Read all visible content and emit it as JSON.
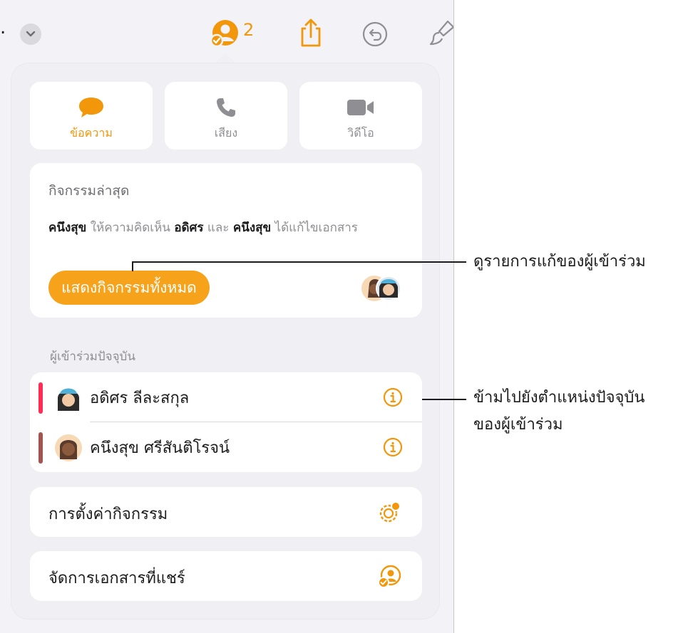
{
  "toolbar": {
    "overflow_text": ".",
    "collaborator_count": "2"
  },
  "contact_buttons": [
    {
      "label": "ข้อความ",
      "icon": "message-bubble-icon",
      "active": true
    },
    {
      "label": "เสียง",
      "icon": "phone-icon",
      "active": false
    },
    {
      "label": "วิดีโอ",
      "icon": "video-camera-icon",
      "active": false
    }
  ],
  "activity": {
    "title": "กิจกรรมล่าสุด",
    "desc_name1": "คนึงสุข",
    "desc_text1": " ให้ความคิดเห็น ",
    "desc_name2": "อดิศร",
    "desc_text2": " และ ",
    "desc_name3": "คนึงสุข",
    "desc_text3": " ได้แก้ไขเอกสาร",
    "show_all_label": "แสดงกิจกรรมทั้งหมด"
  },
  "participants": {
    "header": "ผู้เข้าร่วมปัจจุบัน",
    "items": [
      {
        "name": "อดิศร ลีละสกุล",
        "color": "#ff2d55"
      },
      {
        "name": "คนึงสุข ศรีสันติโรจน์",
        "color": "#a2554f"
      }
    ]
  },
  "activity_settings_label": "การตั้งค่ากิจกรรม",
  "manage_shared_label": "จัดการเอกสารที่แชร์",
  "callouts": {
    "view_changes": "ดูรายการแก้ของผู้เข้าร่วม",
    "jump_line1": "ข้ามไปยังตำแหน่งปัจจุบัน",
    "jump_line2": "ของผู้เข้าร่วม"
  },
  "colors": {
    "accent": "#f2960a",
    "button_fill": "#f7a21b",
    "inactive_icon": "#8e8e93"
  }
}
